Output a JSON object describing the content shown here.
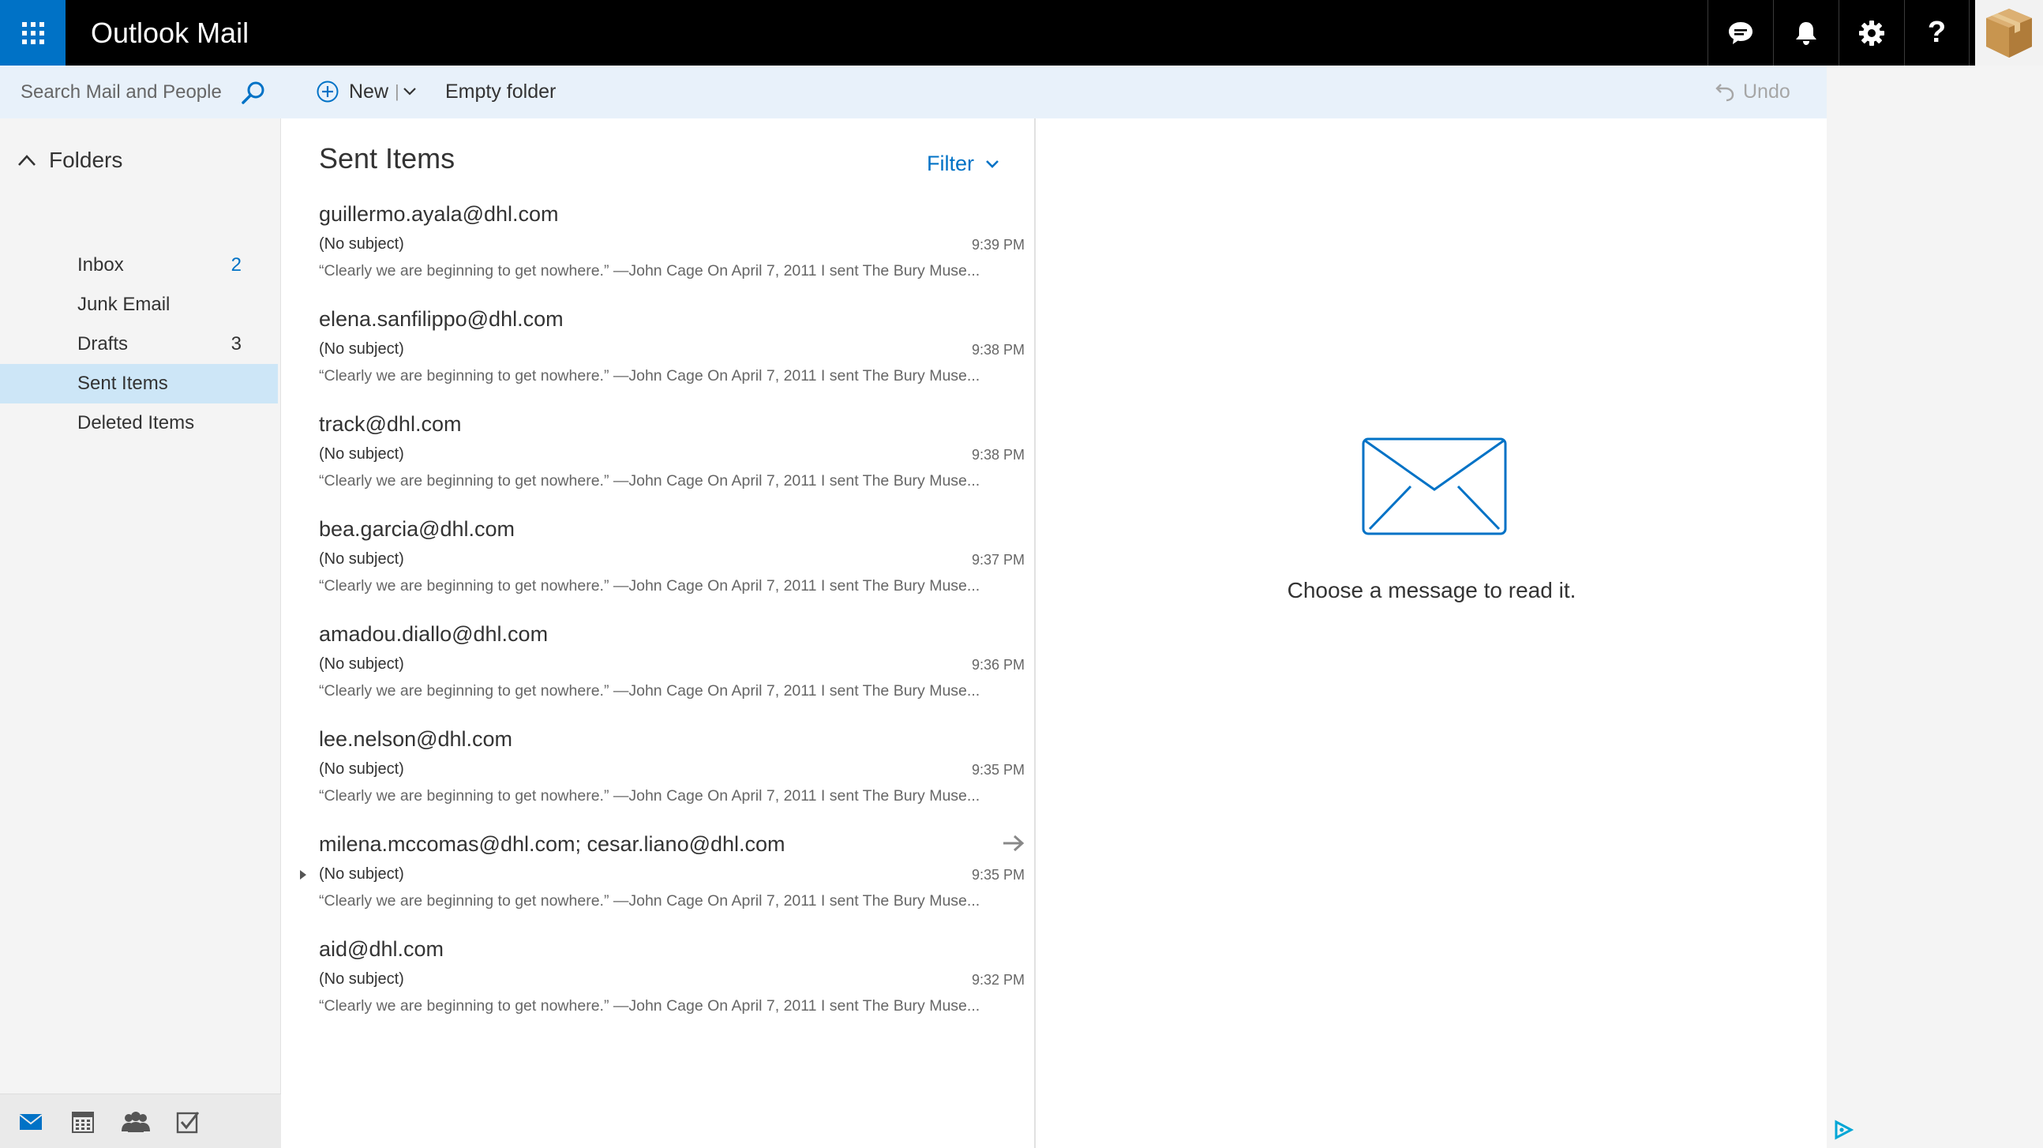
{
  "app": {
    "title": "Outlook Mail"
  },
  "topbar": {
    "icons": [
      "app-launcher-icon",
      "chat-icon",
      "bell-icon",
      "gear-icon",
      "help-icon",
      "package-avatar-icon"
    ],
    "help_glyph": "?"
  },
  "search": {
    "placeholder": "Search Mail and People"
  },
  "folders": {
    "header": "Folders",
    "items": [
      {
        "label": "Inbox",
        "count": "2",
        "unread": true,
        "selected": false
      },
      {
        "label": "Junk Email",
        "count": "",
        "unread": false,
        "selected": false
      },
      {
        "label": "Drafts",
        "count": "3",
        "unread": false,
        "selected": false
      },
      {
        "label": "Sent Items",
        "count": "",
        "unread": false,
        "selected": true
      },
      {
        "label": "Deleted Items",
        "count": "",
        "unread": false,
        "selected": false
      }
    ]
  },
  "toolbar": {
    "new_label": "New",
    "new_separator": "|",
    "empty_folder_label": "Empty folder",
    "undo_label": "Undo"
  },
  "list": {
    "title": "Sent Items",
    "filter_label": "Filter",
    "messages": [
      {
        "sender": "guillermo.ayala@dhl.com",
        "subject": "(No subject)",
        "time": "9:39 PM",
        "preview": "“Clearly we are beginning to get nowhere.” —John Cage   On April 7, 2011 I sent The Bury Muse..."
      },
      {
        "sender": "elena.sanfilippo@dhl.com",
        "subject": "(No subject)",
        "time": "9:38 PM",
        "preview": "“Clearly we are beginning to get nowhere.” —John Cage   On April 7, 2011 I sent The Bury Muse..."
      },
      {
        "sender": "track@dhl.com",
        "subject": "(No subject)",
        "time": "9:38 PM",
        "preview": "“Clearly we are beginning to get nowhere.” —John Cage   On April 7, 2011 I sent The Bury Muse..."
      },
      {
        "sender": "bea.garcia@dhl.com",
        "subject": "(No subject)",
        "time": "9:37 PM",
        "preview": "“Clearly we are beginning to get nowhere.” —John Cage   On April 7, 2011 I sent The Bury Muse..."
      },
      {
        "sender": "amadou.diallo@dhl.com",
        "subject": "(No subject)",
        "time": "9:36 PM",
        "preview": "“Clearly we are beginning to get nowhere.” —John Cage   On April 7, 2011 I sent The Bury Muse..."
      },
      {
        "sender": "lee.nelson@dhl.com",
        "subject": "(No subject)",
        "time": "9:35 PM",
        "preview": "“Clearly we are beginning to get nowhere.” —John Cage   On April 7, 2011 I sent The Bury Muse..."
      },
      {
        "sender": "milena.mccomas@dhl.com; cesar.liano@dhl.com",
        "subject": "(No subject)",
        "time": "9:35 PM",
        "preview": "“Clearly we are beginning to get nowhere.” —John Cage   On April 7, 2011 I sent The Bury Muse...",
        "forwarded": true,
        "thread": true
      },
      {
        "sender": "aid@dhl.com",
        "subject": "(No subject)",
        "time": "9:32 PM",
        "preview": "“Clearly we are beginning to get nowhere.” —John Cage   On April 7, 2011 I sent The Bury Muse..."
      }
    ]
  },
  "reading_pane": {
    "empty_message": "Choose a message to read it."
  },
  "bottom_nav": {
    "icons": [
      "mail-icon",
      "calendar-icon",
      "people-icon",
      "tasks-icon"
    ]
  },
  "colors": {
    "accent": "#0072c6",
    "topbar": "#000000",
    "selected": "#cde6f7",
    "command_bar": "#e8f1fa"
  }
}
